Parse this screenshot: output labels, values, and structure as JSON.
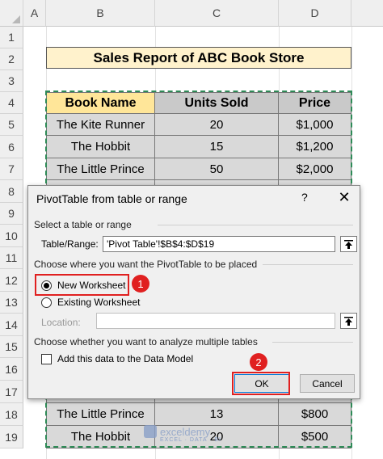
{
  "columns": [
    "A",
    "B",
    "C",
    "D"
  ],
  "rows": [
    "1",
    "2",
    "3",
    "4",
    "5",
    "6",
    "7",
    "8",
    "9",
    "10",
    "11",
    "12",
    "13",
    "14",
    "15",
    "16",
    "17",
    "18",
    "19"
  ],
  "report_title": "Sales Report of ABC Book Store",
  "table_headers": [
    "Book Name",
    "Units Sold",
    "Price"
  ],
  "table_rows_top": [
    [
      "The Kite Runner",
      "20",
      "$1,000"
    ],
    [
      "The Hobbit",
      "15",
      "$1,200"
    ],
    [
      "The Little Prince",
      "50",
      "$2,000"
    ]
  ],
  "table_rows_bottom": [
    [
      "The Little Prince",
      "13",
      "$800"
    ],
    [
      "The Hobbit",
      "20",
      "$500"
    ]
  ],
  "dialog": {
    "title": "PivotTable from table or range",
    "help": "?",
    "close": "✕",
    "section1": "Select a table or range",
    "table_range_label": "Table/Range:",
    "table_range_value": "'Pivot Table'!$B$4:$D$19",
    "section2": "Choose where you want the PivotTable to be placed",
    "option_new": "New Worksheet",
    "option_existing": "Existing Worksheet",
    "location_label": "Location:",
    "location_value": "",
    "section3": "Choose whether you want to analyze multiple tables",
    "data_model_label": "Add this data to the Data Model",
    "ok": "OK",
    "cancel": "Cancel",
    "selected_option": "new_worksheet",
    "data_model_checked": false
  },
  "annotations": {
    "badge1": "1",
    "badge2": "2",
    "color": "#e02020"
  },
  "watermark": {
    "name": "exceldemy",
    "tagline": "EXCEL · DATA · BI"
  },
  "colors": {
    "header_yellow": "#ffe699",
    "header_gray": "#c9c9c9",
    "title_fill": "#fff2cc",
    "data_gray": "#d9d9d9",
    "marquee": "#2e8b57"
  }
}
